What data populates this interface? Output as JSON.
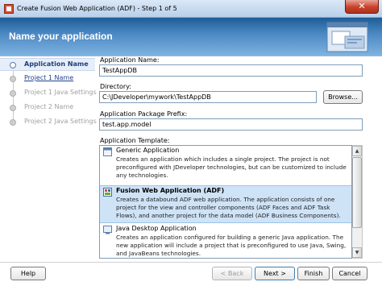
{
  "window": {
    "title": "Create Fusion Web Application (ADF) - Step 1 of 5",
    "close_label": "✕"
  },
  "header": {
    "title": "Name your application"
  },
  "nav": {
    "items": [
      {
        "label": "Application Name",
        "state": "active"
      },
      {
        "label": "Project 1 Name",
        "state": "link"
      },
      {
        "label": "Project 1 Java Settings",
        "state": "disabled"
      },
      {
        "label": "Project 2 Name",
        "state": "disabled"
      },
      {
        "label": "Project 2 Java Settings",
        "state": "disabled"
      }
    ]
  },
  "form": {
    "app_name": {
      "label": "Application Name:",
      "value": "TestAppDB"
    },
    "directory": {
      "label": "Directory:",
      "value": "C:\\JDeveloper\\mywork\\TestAppDB",
      "browse_label": "Browse..."
    },
    "package": {
      "label": "Application Package Prefix:",
      "value": "test.app.model"
    },
    "template": {
      "label": "Application Template:",
      "items": [
        {
          "name": "Generic Application",
          "desc": "Creates an application which includes a single project. The project is not preconfigured with JDeveloper technologies, but can be customized to include any technologies."
        },
        {
          "name": "Fusion Web Application (ADF)",
          "desc": "Creates a databound ADF web application. The application consists of one project for the view and controller components (ADF Faces and ADF Task Flows), and another project for the data model (ADF Business Components)."
        },
        {
          "name": "Java Desktop Application",
          "desc": "Creates an application configured for building a generic Java application. The new application will include a project that is preconfigured to use Java, Swing, and JavaBeans technologies."
        }
      ],
      "selected_index": 1
    }
  },
  "footer": {
    "help": "Help",
    "back": "< Back",
    "next": "Next >",
    "finish": "Finish",
    "cancel": "Cancel"
  },
  "colors": {
    "header_dark": "#1e5c96",
    "header_light": "#7fb3e0",
    "selected_row": "#cfe3f7",
    "link": "#1d3f8f"
  }
}
